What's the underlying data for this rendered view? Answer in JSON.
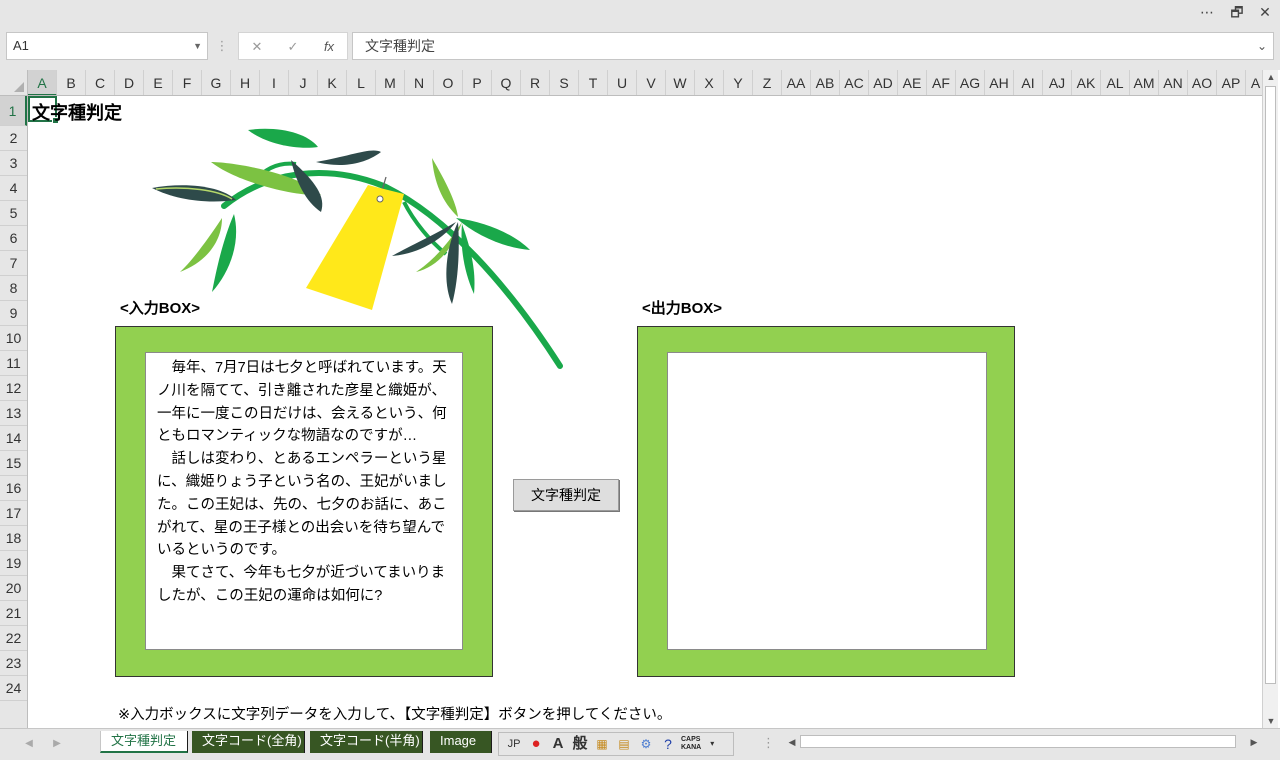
{
  "window": {
    "more_label": "⋯",
    "restore_label": "🗗",
    "close_label": "✕"
  },
  "formula_bar": {
    "name_box": "A1",
    "cancel_glyph": "✕",
    "enter_glyph": "✓",
    "fx_glyph": "fx",
    "content": "文字種判定"
  },
  "columns": [
    "A",
    "B",
    "C",
    "D",
    "E",
    "F",
    "G",
    "H",
    "I",
    "J",
    "K",
    "L",
    "M",
    "N",
    "O",
    "P",
    "Q",
    "R",
    "S",
    "T",
    "U",
    "V",
    "W",
    "X",
    "Y",
    "Z",
    "AA",
    "AB",
    "AC",
    "AD",
    "AE",
    "AF",
    "AG",
    "AH",
    "AI",
    "AJ",
    "AK",
    "AL",
    "AM",
    "AN",
    "AO",
    "AP",
    "A"
  ],
  "rows": [
    "1",
    "2",
    "3",
    "4",
    "5",
    "6",
    "7",
    "8",
    "9",
    "10",
    "11",
    "12",
    "13",
    "14",
    "15",
    "16",
    "17",
    "18",
    "19",
    "20",
    "21",
    "22",
    "23",
    "24"
  ],
  "sheet": {
    "title": "文字種判定",
    "input_label": "<入力BOX>",
    "output_label": "<出力BOX>",
    "input_text": "　毎年、7月7日は七夕と呼ばれています。天ノ川を隔てて、引き離された彦星と織姫が、一年に一度この日だけは、会えるという、何ともロマンティックな物語なのですが…\n　話しは変わり、とあるエンペラーという星に、織姫りょう子という名の、王妃がいました。この王妃は、先の、七夕のお話に、あこがれて、星の王子様との出会いを待ち望んでいるというのです。\n　果てさて、今年も七夕が近づいてまいりましたが、この王妃の運命は如何に?",
    "output_text": "",
    "button_label": "文字種判定",
    "note": "※入力ボックスに文字列データを入力して、【文字種判定】ボタンを押してください。"
  },
  "tabs": [
    {
      "label": "文字種判定",
      "active": true
    },
    {
      "label": "文字コード(全角)",
      "active": false
    },
    {
      "label": "文字コード(半角)",
      "active": false
    },
    {
      "label": "Image",
      "active": false
    }
  ],
  "ime": {
    "mode": "JP",
    "caps": "CAPS",
    "kana": "KANA",
    "a_glyph": "A",
    "han_glyph": "般"
  },
  "colors": {
    "accent": "#217346",
    "box_green": "#92d050",
    "tab_dark": "#375623",
    "tanzaku": "#ffe81a",
    "leaf": "#1aa84a",
    "leaf_light": "#7cc242",
    "leaf_dark": "#2e4a4a"
  }
}
